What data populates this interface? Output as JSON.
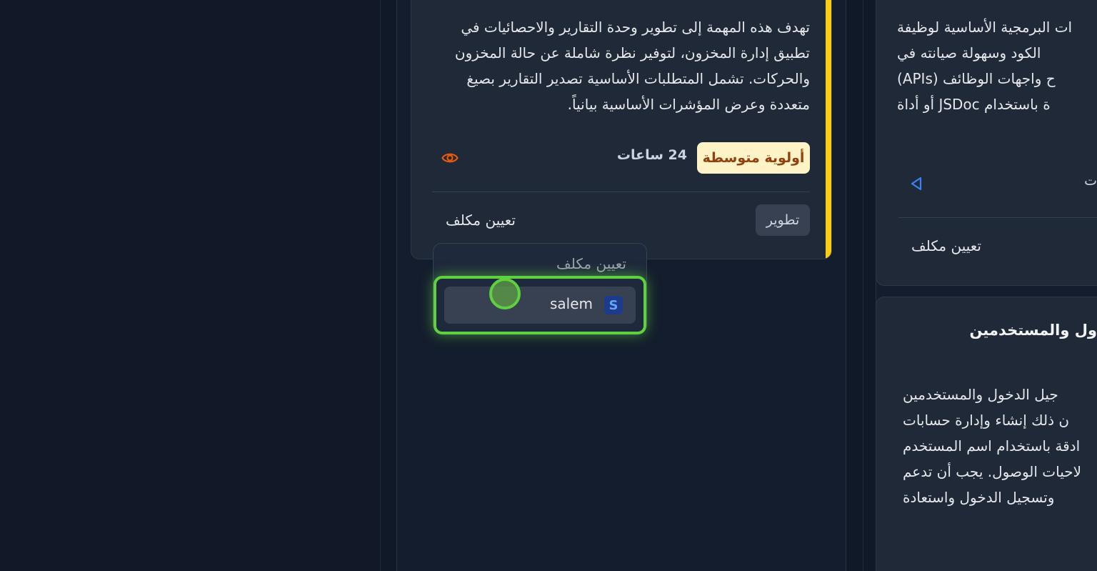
{
  "main_card": {
    "description_lines": [
      "تهدف هذه المهمة إلى تطوير وحدة التقارير والاحصائيات في",
      "تطبيق إدارة المخزون، لتوفير نظرة شاملة عن حالة المخزون",
      "والحركات. تشمل المتطلبات الأساسية تصدير التقارير بصيغ",
      "متعددة وعرض المؤشرات الأساسية بيانياً."
    ],
    "priority_badge": "أولوية متوسطة",
    "hours": "24 ساعات",
    "view_icon": "eye-icon",
    "tag": "تطوير",
    "assign_label": "تعيين مكلف",
    "stripe_color": "#facc15"
  },
  "assign_dropdown": {
    "title": "تعيين مكلف",
    "options": [
      {
        "avatar_letter": "S",
        "name": "salem"
      }
    ]
  },
  "right_card_top": {
    "description_lines": [
      "ات البرمجية الأساسية لوظيفة",
      "الكود وسهولة صيانته في",
      "ح واجهات الوظائف (APIs)",
      "ة باستخدام JSDoc أو أداة"
    ],
    "meta_text": "ت",
    "toggle_icon": "triangle-left-icon",
    "assign_label": "تعيين مكلف"
  },
  "right_card_bottom": {
    "title": "ول والمستخدمين",
    "description_lines": [
      "جيل الدخول والمستخدمين",
      "ن ذلك إنشاء وإدارة حسابات",
      "ادقة باستخدام اسم المستخدم",
      "لاحيات الوصول. يجب أن تدعم",
      "وتسجيل الدخول واستعادة"
    ]
  }
}
